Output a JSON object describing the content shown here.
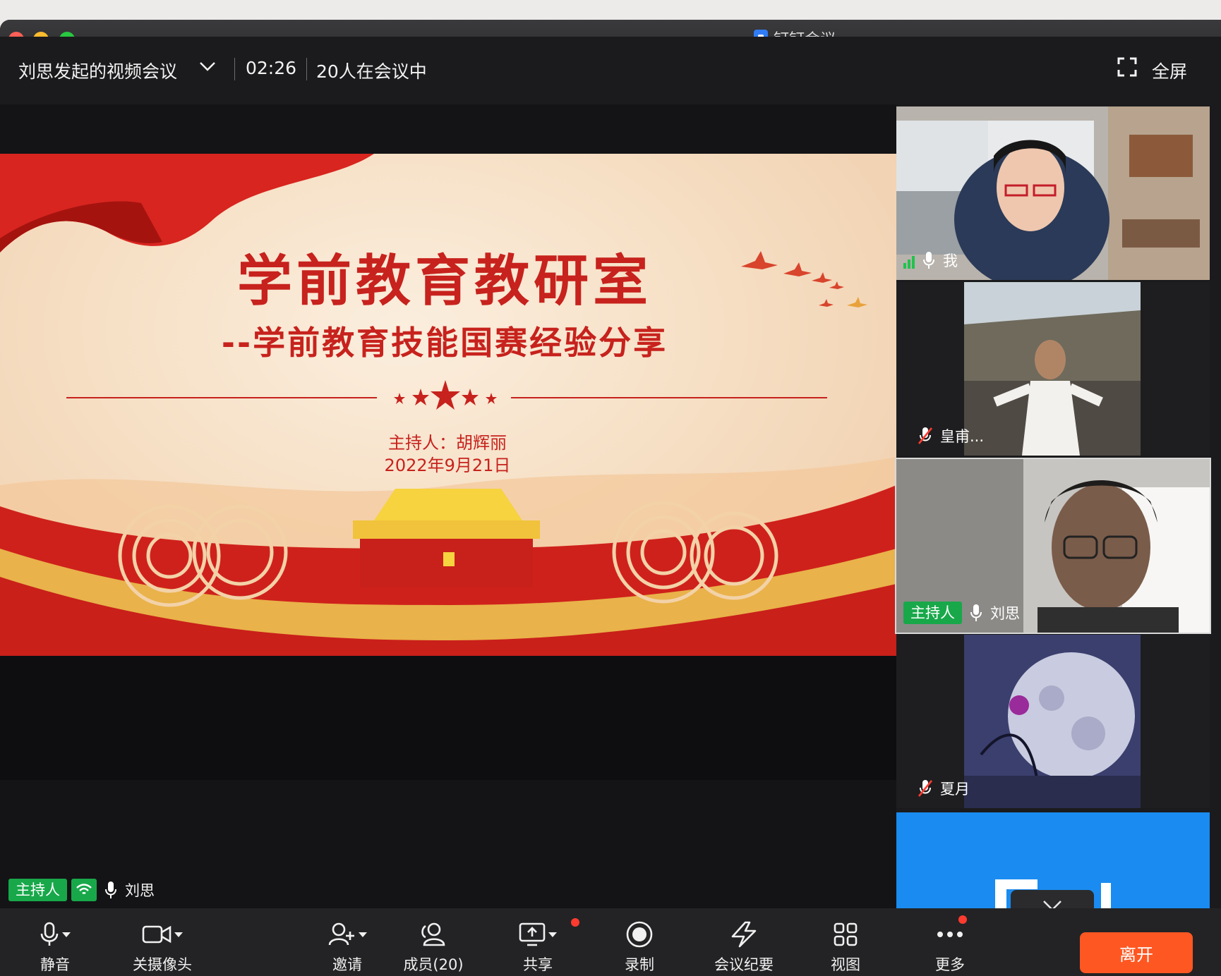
{
  "window": {
    "title": "钉钉会议"
  },
  "meeting": {
    "title": "刘思发起的视频会议",
    "elapsed": "02:26",
    "participants_status": "20人在会议中",
    "fullscreen_label": "全屏"
  },
  "slide": {
    "title": "学前教育教研室",
    "subtitle": "--学前教育技能国赛经验分享",
    "host_line": "主持人：胡辉丽",
    "date_line": "2022年9月21日"
  },
  "stage_label": {
    "host_tag": "主持人",
    "name": "刘思"
  },
  "participants": [
    {
      "name": "我",
      "muted": false
    },
    {
      "name": "皇甫...",
      "muted": true
    },
    {
      "name": "刘思",
      "muted": false,
      "host_tag": "主持人"
    },
    {
      "name": "夏月",
      "muted": true
    },
    {
      "name": ""
    }
  ],
  "toolbar": {
    "mute": "静音",
    "camera": "关摄像头",
    "invite": "邀请",
    "members": "成员(20)",
    "share": "共享",
    "record": "录制",
    "minutes": "会议纪要",
    "view": "视图",
    "more": "更多",
    "leave": "离开"
  },
  "colors": {
    "host_green": "#18a84a",
    "leave_orange": "#ff5722",
    "accent_blue": "#1a8bf0",
    "slide_red": "#c7221d"
  }
}
